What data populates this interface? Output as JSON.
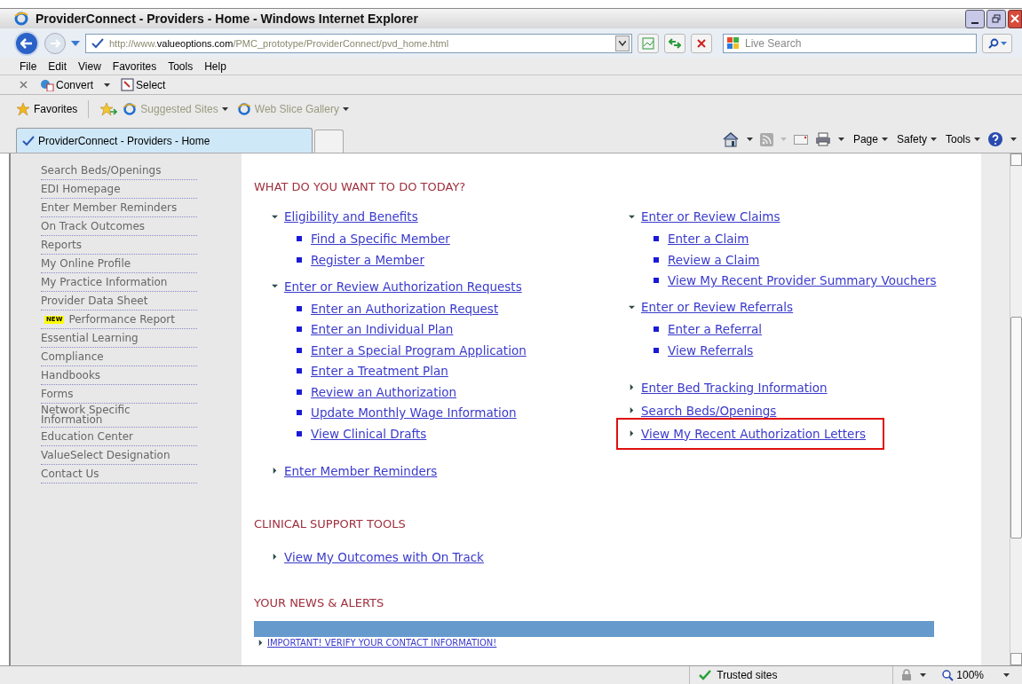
{
  "window": {
    "title": "ProviderConnect - Providers - Home - Windows Internet Explorer"
  },
  "address_bar": {
    "url_prefix": "http://www.",
    "url_domain": "valueoptions.com",
    "url_path": "/PMC_prototype/ProviderConnect/pvd_home.html"
  },
  "search": {
    "placeholder": "Live Search"
  },
  "menu": [
    "File",
    "Edit",
    "View",
    "Favorites",
    "Tools",
    "Help"
  ],
  "toolbar": [
    "Convert",
    "Select"
  ],
  "favorites_bar": {
    "label": "Favorites",
    "items": [
      "Suggested Sites",
      "Web Slice Gallery"
    ]
  },
  "tabs": [
    {
      "title": "ProviderConnect - Providers - Home",
      "selected": true
    }
  ],
  "command_bar": [
    "Page",
    "Safety",
    "Tools"
  ],
  "sidebar": {
    "items": [
      {
        "label": "Search Beds/Openings"
      },
      {
        "label": "EDI Homepage"
      },
      {
        "label": "Enter Member Reminders"
      },
      {
        "label": "On Track Outcomes"
      },
      {
        "label": "Reports"
      },
      {
        "label": "My Online Profile"
      },
      {
        "label": "My Practice Information"
      },
      {
        "label": "Provider Data Sheet"
      },
      {
        "label": "Performance Report",
        "badge": "NEW"
      },
      {
        "label": "Essential Learning"
      },
      {
        "label": "Compliance"
      },
      {
        "label": "Handbooks"
      },
      {
        "label": "Forms"
      },
      {
        "label": "Network Specific Information"
      },
      {
        "label": "Education Center"
      },
      {
        "label": "ValueSelect Designation"
      },
      {
        "label": "Contact Us"
      }
    ]
  },
  "sections": [
    {
      "heading": "WHAT DO YOU WANT TO DO TODAY?",
      "columns": [
        [
          {
            "label": "Eligibility and Benefits",
            "expanded": true,
            "children": [
              "Find a Specific Member",
              "Register a Member"
            ]
          },
          {
            "label": "Enter or Review Authorization Requests",
            "expanded": true,
            "children": [
              "Enter an Authorization Request",
              "Enter an Individual Plan",
              "Enter a Special Program Application",
              "Enter a Treatment Plan",
              "Review an Authorization",
              "Update Monthly Wage Information",
              "View Clinical Drafts"
            ]
          },
          {
            "label": "Enter Member Reminders",
            "expanded": false
          }
        ],
        [
          {
            "label": "Enter or Review Claims",
            "expanded": true,
            "children": [
              "Enter a Claim",
              "Review a Claim",
              "View My Recent Provider Summary Vouchers"
            ]
          },
          {
            "label": "Enter or Review Referrals",
            "expanded": true,
            "children": [
              "Enter a Referral",
              "View Referrals"
            ]
          },
          {
            "label": "Enter Bed Tracking Information",
            "expanded": false
          },
          {
            "label": "Search Beds/Openings",
            "expanded": false
          },
          {
            "label": "View My Recent Authorization Letters",
            "expanded": false,
            "highlighted": true
          }
        ]
      ]
    },
    {
      "heading": "CLINICAL SUPPORT TOOLS",
      "columns": [
        [
          {
            "label": "View My Outcomes with On Track",
            "expanded": false
          }
        ]
      ]
    },
    {
      "heading": "YOUR NEWS & ALERTS",
      "news": [
        "IMPORTANT! VERIFY YOUR CONTACT INFORMATION!"
      ]
    }
  ],
  "status_bar": {
    "zone": "Trusted sites",
    "zoom": "100%"
  }
}
